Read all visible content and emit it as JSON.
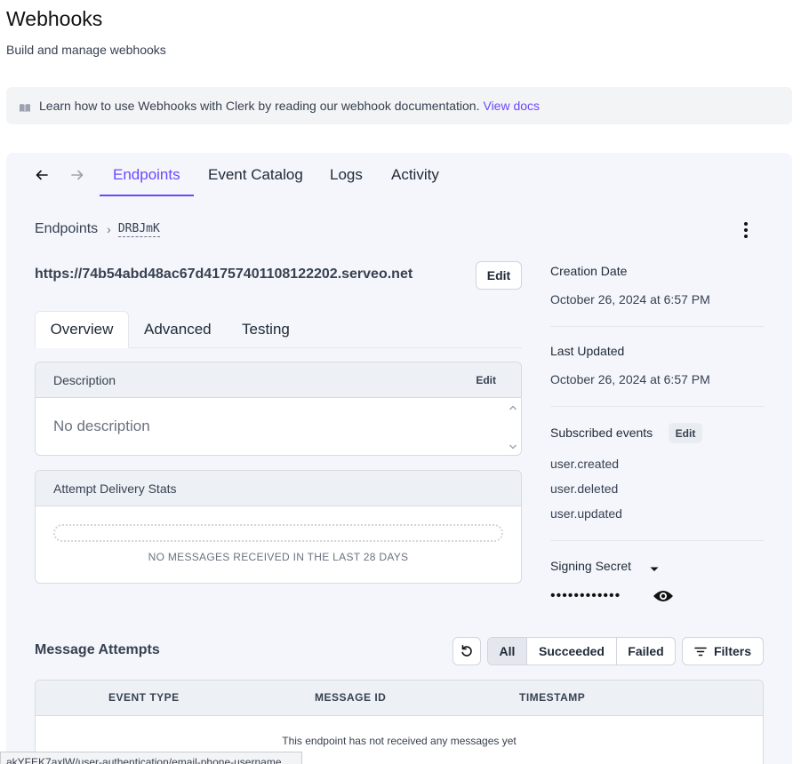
{
  "header": {
    "title": "Webhooks",
    "subtitle": "Build and manage webhooks"
  },
  "banner": {
    "icon": "book-icon",
    "text": "Learn how to use Webhooks with Clerk by reading our webhook documentation.",
    "link": "View docs",
    "link_color": "#6c47ff"
  },
  "nav": {
    "back_icon": "arrow-left-icon",
    "forward_icon": "arrow-right-icon",
    "tabs": [
      {
        "label": "Endpoints",
        "active": true
      },
      {
        "label": "Event Catalog",
        "active": false
      },
      {
        "label": "Logs",
        "active": false
      },
      {
        "label": "Activity",
        "active": false
      }
    ]
  },
  "breadcrumb": {
    "root": "Endpoints",
    "separator": "›",
    "current": "DRBJmK"
  },
  "endpoint": {
    "url": "https://74b54abd48ac67d41757401108122202.serveo.net",
    "edit_label": "Edit"
  },
  "sub_tabs": [
    {
      "label": "Overview",
      "active": true
    },
    {
      "label": "Advanced",
      "active": false
    },
    {
      "label": "Testing",
      "active": false
    }
  ],
  "description_card": {
    "title": "Description",
    "edit_label": "Edit",
    "body": "No description"
  },
  "stats_card": {
    "title": "Attempt Delivery Stats",
    "empty_text": "NO MESSAGES RECEIVED IN THE LAST 28 DAYS"
  },
  "details": {
    "creation_label": "Creation Date",
    "creation_value": "October 26, 2024 at 6:57 PM",
    "updated_label": "Last Updated",
    "updated_value": "October 26, 2024 at 6:57 PM",
    "events_label": "Subscribed events",
    "events_edit": "Edit",
    "events": [
      "user.created",
      "user.deleted",
      "user.updated"
    ],
    "secret_label": "Signing Secret",
    "secret_value": "••••••••••••"
  },
  "attempts": {
    "title": "Message Attempts",
    "filters": [
      "All",
      "Succeeded",
      "Failed"
    ],
    "selected_filter": "All",
    "filters_button": "Filters",
    "columns": [
      "EVENT TYPE",
      "MESSAGE ID",
      "TIMESTAMP"
    ],
    "empty_text": "This endpoint has not received any messages yet"
  },
  "status_bar": {
    "text": "akYFEK7axlW/user-authentication/email-phone-username"
  },
  "colors": {
    "accent": "#6c47ff",
    "panel_bg": "#f4f6fb"
  }
}
